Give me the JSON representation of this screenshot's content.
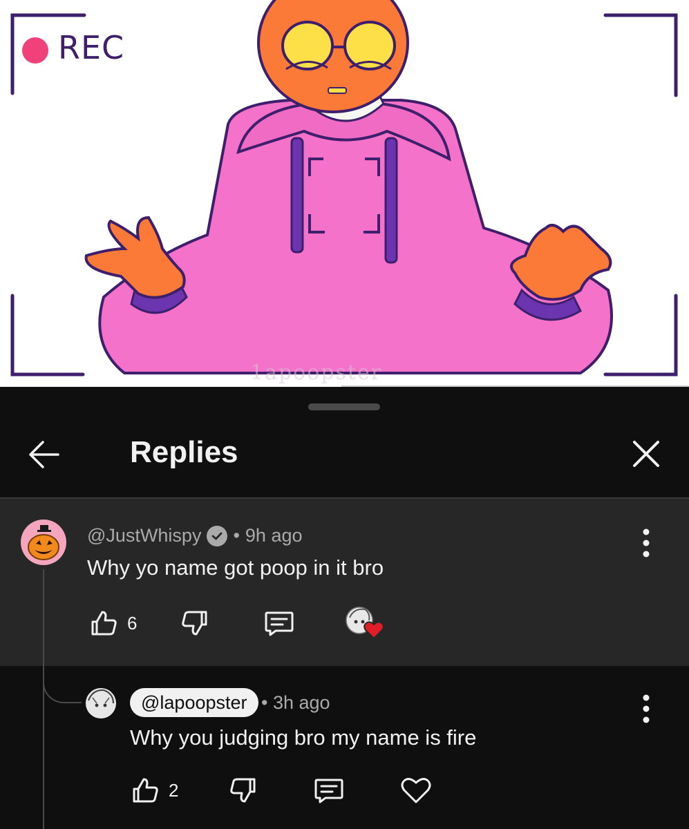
{
  "video": {
    "rec_label": "REC",
    "watermark": "1apoopster",
    "rec_color": "#f0417a",
    "frame_color": "#3d1f6b",
    "progress": 0.495
  },
  "panel": {
    "title": "Replies",
    "back_icon": "arrow-left-icon",
    "close_icon": "close-icon"
  },
  "comment": {
    "author": "@JustWhispy",
    "verified": true,
    "separator": "•",
    "time": "9h ago",
    "text": "Why yo name got poop in it bro",
    "likes": "6",
    "creator_heart": true,
    "avatar_icon": "jack-o-lantern-icon"
  },
  "reply": {
    "mention": "@lapoopster",
    "separator": "•",
    "time": "3h ago",
    "text": "Why you judging bro my name is fire",
    "likes": "2"
  },
  "colors": {
    "sheet_bg": "#0f0f0f",
    "highlight_bg": "#272727",
    "text_primary": "#f1f1f1",
    "text_secondary": "#aaaaaa",
    "heart": "#e11d2a"
  }
}
